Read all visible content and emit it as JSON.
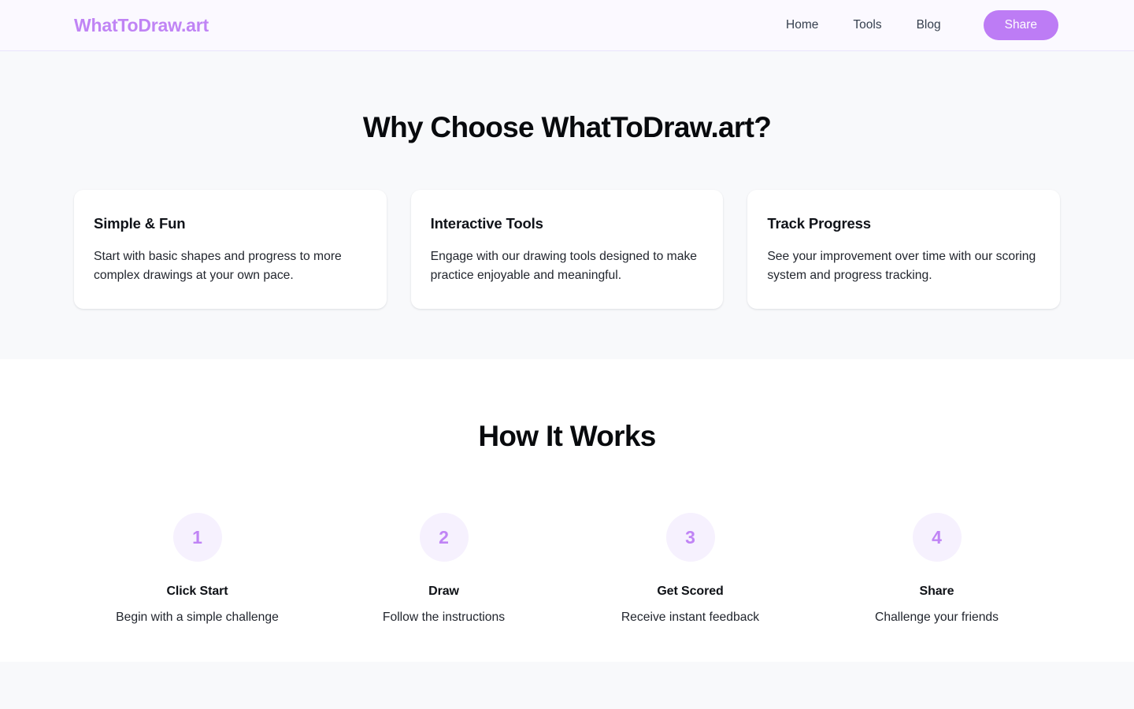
{
  "header": {
    "brand": "WhatToDraw.art",
    "nav": [
      {
        "label": "Home",
        "name": "nav-link-home"
      },
      {
        "label": "Tools",
        "name": "nav-link-tools"
      },
      {
        "label": "Blog",
        "name": "nav-link-blog"
      }
    ],
    "share_label": "Share",
    "colors": {
      "brand": "#c084f5",
      "share_bg": "#bd7cf5",
      "share_text": "#ffffff",
      "header_bg": "#fbf9ff",
      "header_border": "#e9e4fb"
    }
  },
  "why_section": {
    "title": "Why Choose WhatToDraw.art?",
    "bg": "#f8f9fb",
    "cards": [
      {
        "title": "Simple & Fun",
        "description": "Start with basic shapes and progress to more complex drawings at your own pace."
      },
      {
        "title": "Interactive Tools",
        "description": "Engage with our drawing tools designed to make practice enjoyable and meaningful."
      },
      {
        "title": "Track Progress",
        "description": "See your improvement over time with our scoring system and progress tracking."
      }
    ]
  },
  "how_section": {
    "title": "How It Works",
    "bg": "#ffffff",
    "circle_bg": "#f6f1fe",
    "circle_text": "#c084f5",
    "steps": [
      {
        "number": "1",
        "title": "Click Start",
        "description": "Begin with a simple challenge"
      },
      {
        "number": "2",
        "title": "Draw",
        "description": "Follow the instructions"
      },
      {
        "number": "3",
        "title": "Get Scored",
        "description": "Receive instant feedback"
      },
      {
        "number": "4",
        "title": "Share",
        "description": "Challenge your friends"
      }
    ]
  },
  "bottom_strip": {
    "bg": "#f8f9fb"
  }
}
